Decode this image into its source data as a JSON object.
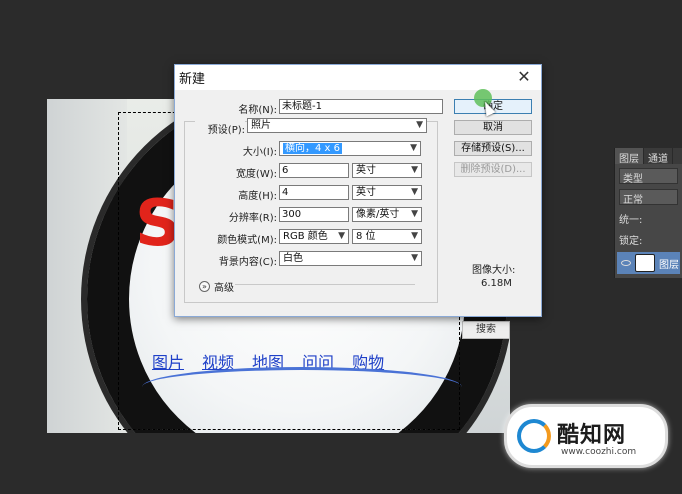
{
  "background_canvas": {
    "nav_links": [
      "图片",
      "视频",
      "地图",
      "问问",
      "购物"
    ],
    "search_button": "搜索",
    "logo_letter": "S"
  },
  "right_panel": {
    "tabs": [
      "图层",
      "通道"
    ],
    "kind_label": "类型",
    "blend_mode": "正常",
    "unify_label": "统一:",
    "lock_label": "锁定:",
    "layer_name": "图层"
  },
  "dialog": {
    "title": "新建",
    "name_label": "名称(N):",
    "name_value": "未标题-1",
    "preset_label": "预设(P):",
    "preset_value": "照片",
    "size_label": "大小(I):",
    "size_value": "横向，4 x 6",
    "width_label": "宽度(W):",
    "width_value": "6",
    "width_unit": "英寸",
    "height_label": "高度(H):",
    "height_value": "4",
    "height_unit": "英寸",
    "resolution_label": "分辨率(R):",
    "resolution_value": "300",
    "resolution_unit": "像素/英寸",
    "color_mode_label": "颜色模式(M):",
    "color_mode_value": "RGB 颜色",
    "bit_depth": "8 位",
    "bg_contents_label": "背景内容(C):",
    "bg_contents_value": "白色",
    "advanced_label": "高级",
    "ok_button": "确定",
    "cancel_button": "取消",
    "save_preset_button": "存储预设(S)...",
    "delete_preset_button": "删除预设(D)...",
    "image_size_label": "图像大小:",
    "image_size_value": "6.18M"
  },
  "watermark": {
    "text": "酷知网",
    "url": "www.coozhi.com"
  },
  "colors": {
    "accent": "#3399ff",
    "dialog_bg": "#f0f0f0",
    "app_bg": "#2b2b2b"
  }
}
